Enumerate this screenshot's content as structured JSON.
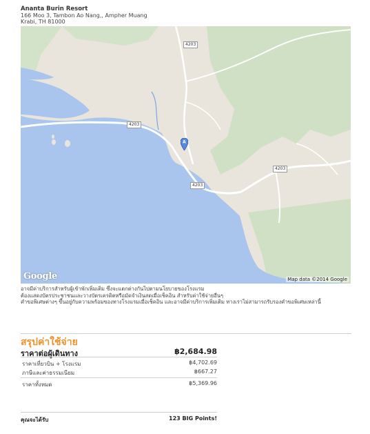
{
  "hotel": {
    "name": "Ananta Burin Resort",
    "address_line1": "166 Moo 3, Tambon Ao Nang,, Ampher Muang",
    "address_line2": "Krabi, TH 81000"
  },
  "map": {
    "logo_text": "Google",
    "credit": "Map data ©2014 Google",
    "marker_label": "A",
    "road_labels": [
      "4203",
      "4203",
      "4203",
      "4203"
    ],
    "colors": {
      "water": "#a9c5ee",
      "land": "#e9e5dc",
      "forest": "#cfe0c4",
      "road": "#ffffff"
    }
  },
  "notes": [
    "อาจมีค่าบริการสำหรับผู้เข้าพักเพิ่มเติม ซึ่งจะแตกต่างกันไปตามนโยบายของโรงแรม",
    "ต้องแสดงบัตรประชาชนและวางบัตรเครดิตหรือมัดจำเงินสดเมื่อเช็คอิน สำหรับค่าใช้จ่ายอื่นๆ",
    "คำขอพิเศษต่างๆ ขึ้นอยู่กับความพร้อมของทางโรงแรมเมื่อเช็คอิน และอาจมีค่าบริการเพิ่มเติม ทางเราไม่สามารถรับรองคำขอพิเศษเหล่านี้"
  ],
  "summary": {
    "title": "สรุปค่าใช้จ่าย",
    "per_person_label": "ราคาต่อผู้เดินทาง",
    "per_person_value": "฿2,684.98",
    "rows": [
      {
        "label": "ราคาเที่ยวบิน + โรงแรม",
        "value": "฿4,702.69"
      },
      {
        "label": "ภาษีและค่าธรรมเนียม",
        "value": "฿667.27"
      }
    ],
    "total_label": "ราคาทั้งหมด",
    "total_value": "฿5,369.96",
    "earn_label": "คุณจะได้รับ",
    "earn_value": "123 BIG Points!"
  }
}
